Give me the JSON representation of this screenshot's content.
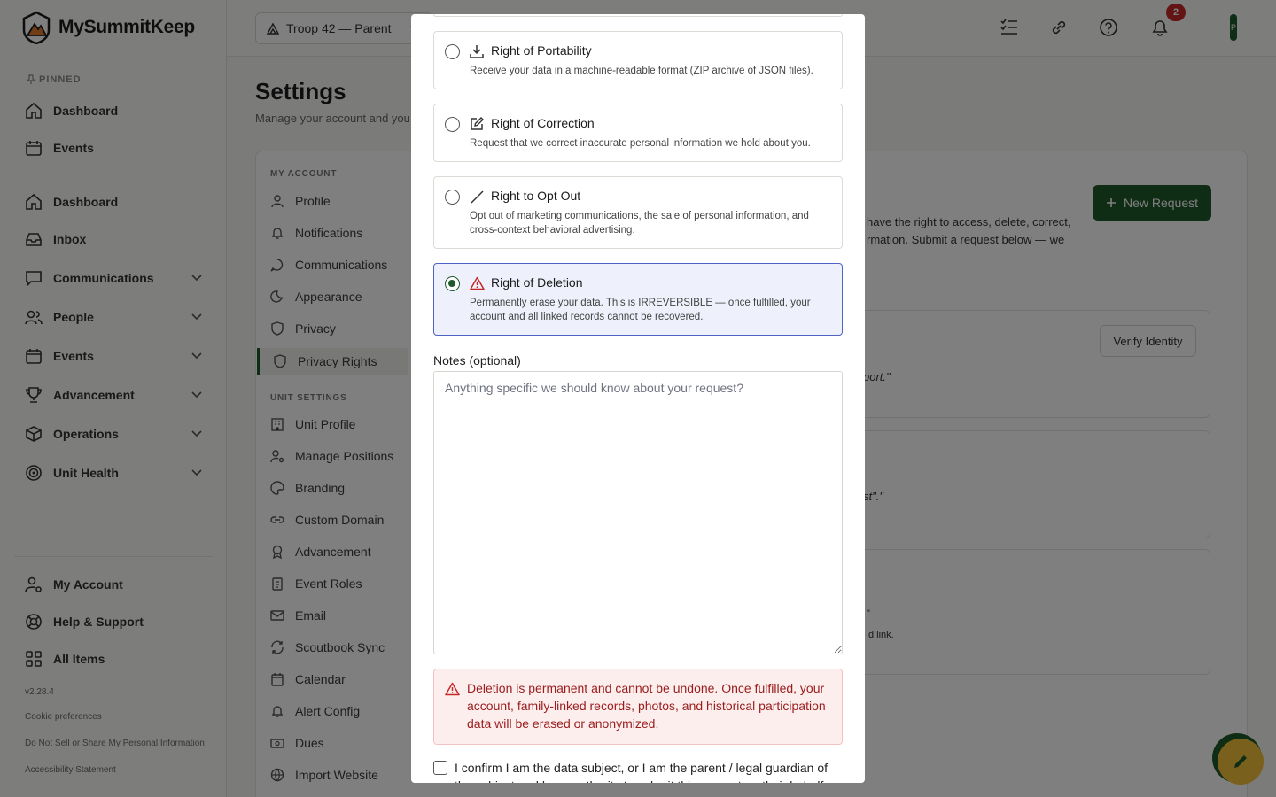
{
  "app": {
    "name": "MySummitKeep",
    "version": "v2.28.4"
  },
  "sidebar": {
    "pinned_label": "PINNED",
    "pinned": [
      {
        "label": "Dashboard",
        "icon": "home-icon"
      },
      {
        "label": "Events",
        "icon": "calendar-icon"
      }
    ],
    "items": [
      {
        "label": "Dashboard",
        "icon": "home-icon"
      },
      {
        "label": "Inbox",
        "icon": "inbox-icon"
      },
      {
        "label": "Communications",
        "icon": "message-icon"
      },
      {
        "label": "People",
        "icon": "users-icon"
      },
      {
        "label": "Events",
        "icon": "calendar-icon"
      },
      {
        "label": "Advancement",
        "icon": "trophy-icon"
      },
      {
        "label": "Operations",
        "icon": "package-icon"
      },
      {
        "label": "Unit Health",
        "icon": "target-icon"
      }
    ],
    "footer_items": [
      {
        "label": "My Account",
        "icon": "user-gear-icon"
      },
      {
        "label": "Help & Support",
        "icon": "lifebuoy-icon"
      },
      {
        "label": "All Items",
        "icon": "grid-icon"
      }
    ],
    "footer_links": [
      "Cookie preferences",
      "Do Not Sell or Share My Personal Information",
      "Accessibility Statement"
    ]
  },
  "header": {
    "unit_selector": "Troop 42 — Parent",
    "notification_count": "2",
    "avatar_initial": "P"
  },
  "main": {
    "title": "Settings",
    "subtitle": "Manage your account and you",
    "nav": {
      "my_account_label": "MY ACCOUNT",
      "my_account": [
        {
          "label": "Profile",
          "icon": "user-icon"
        },
        {
          "label": "Notifications",
          "icon": "bell-icon"
        },
        {
          "label": "Communications",
          "icon": "message-icon"
        },
        {
          "label": "Appearance",
          "icon": "moon-icon"
        },
        {
          "label": "Privacy",
          "icon": "shield-icon"
        },
        {
          "label": "Privacy Rights",
          "icon": "shield-icon"
        }
      ],
      "unit_settings_label": "UNIT SETTINGS",
      "unit_settings": [
        {
          "label": "Unit Profile",
          "icon": "building-icon"
        },
        {
          "label": "Manage Positions",
          "icon": "user-gear-icon"
        },
        {
          "label": "Branding",
          "icon": "palette-icon"
        },
        {
          "label": "Custom Domain",
          "icon": "link-icon"
        },
        {
          "label": "Advancement",
          "icon": "award-icon"
        },
        {
          "label": "Event Roles",
          "icon": "clipboard-icon"
        },
        {
          "label": "Email",
          "icon": "mail-icon"
        },
        {
          "label": "Scoutbook Sync",
          "icon": "refresh-icon"
        },
        {
          "label": "Calendar",
          "icon": "calendar-icon"
        },
        {
          "label": "Alert Config",
          "icon": "bell-icon"
        },
        {
          "label": "Dues",
          "icon": "money-icon"
        },
        {
          "label": "Import Website",
          "icon": "globe-icon"
        }
      ]
    },
    "new_request_label": "New Request",
    "intro_line1": "have the right to access, delete, correct,",
    "intro_line2": "rmation. Submit a request below — we",
    "verify_identity": "Verify Identity",
    "card1_text": "port.\"",
    "card2_text": "st\".\"",
    "card3_line1": "\"",
    "card3_line2": "d link."
  },
  "modal": {
    "options": [
      {
        "title": "Right of Portability",
        "desc": "Receive your data in a machine-readable format (ZIP archive of JSON files).",
        "icon": "download-icon",
        "selected": false
      },
      {
        "title": "Right of Correction",
        "desc": "Request that we correct inaccurate personal information we hold about you.",
        "icon": "edit-icon",
        "selected": false
      },
      {
        "title": "Right to Opt Out",
        "desc": "Opt out of marketing communications, the sale of personal information, and cross-context behavioral advertising.",
        "icon": "slash-icon",
        "selected": false
      },
      {
        "title": "Right of Deletion",
        "desc": "Permanently erase your data. This is IRREVERSIBLE — once fulfilled, your account and all linked records cannot be recovered.",
        "icon": "warning-icon",
        "selected": true
      }
    ],
    "notes_label": "Notes (optional)",
    "notes_placeholder": "Anything specific we should know about your request?",
    "warning_text": "Deletion is permanent and cannot be undone. Once fulfilled, your account, family-linked records, photos, and historical participation data will be erased or anonymized.",
    "confirm_text": "I confirm I am the data subject, or I am the parent / legal guardian of the subject and have authority to submit this request on their behalf."
  },
  "colors": {
    "brand": "#1f5a2b",
    "danger": "#c62828",
    "selected_border": "#4f63c7"
  }
}
